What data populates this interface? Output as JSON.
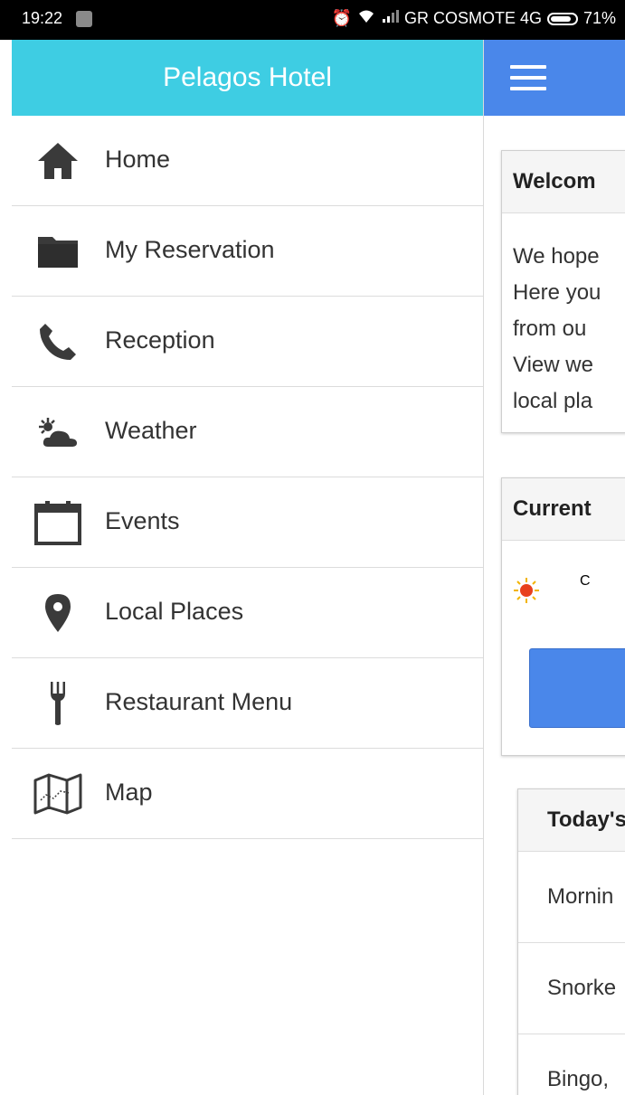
{
  "status_bar": {
    "time": "19:22",
    "carrier": "GR COSMOTE 4G",
    "battery": "71%"
  },
  "drawer": {
    "title": "Pelagos Hotel",
    "header_color": "#3ecde3",
    "items": [
      {
        "label": "Home",
        "icon": "home-icon"
      },
      {
        "label": "My Reservation",
        "icon": "folder-icon"
      },
      {
        "label": "Reception",
        "icon": "phone-icon"
      },
      {
        "label": "Weather",
        "icon": "weather-icon"
      },
      {
        "label": "Events",
        "icon": "calendar-icon"
      },
      {
        "label": "Local Places",
        "icon": "location-pin-icon"
      },
      {
        "label": "Restaurant Menu",
        "icon": "fork-icon"
      },
      {
        "label": "Map",
        "icon": "map-icon"
      }
    ]
  },
  "main": {
    "topbar_color": "#4a87ea",
    "welcome_panel": {
      "title": "Welcom",
      "lines": [
        "We hope",
        "Here you",
        "from ou",
        "View we",
        "local pla"
      ]
    },
    "weather_panel": {
      "title": "Current",
      "text": "C"
    },
    "events_panel": {
      "title": "Today's",
      "rows": [
        "Mornin",
        "Snorke",
        "Bingo,"
      ]
    }
  }
}
